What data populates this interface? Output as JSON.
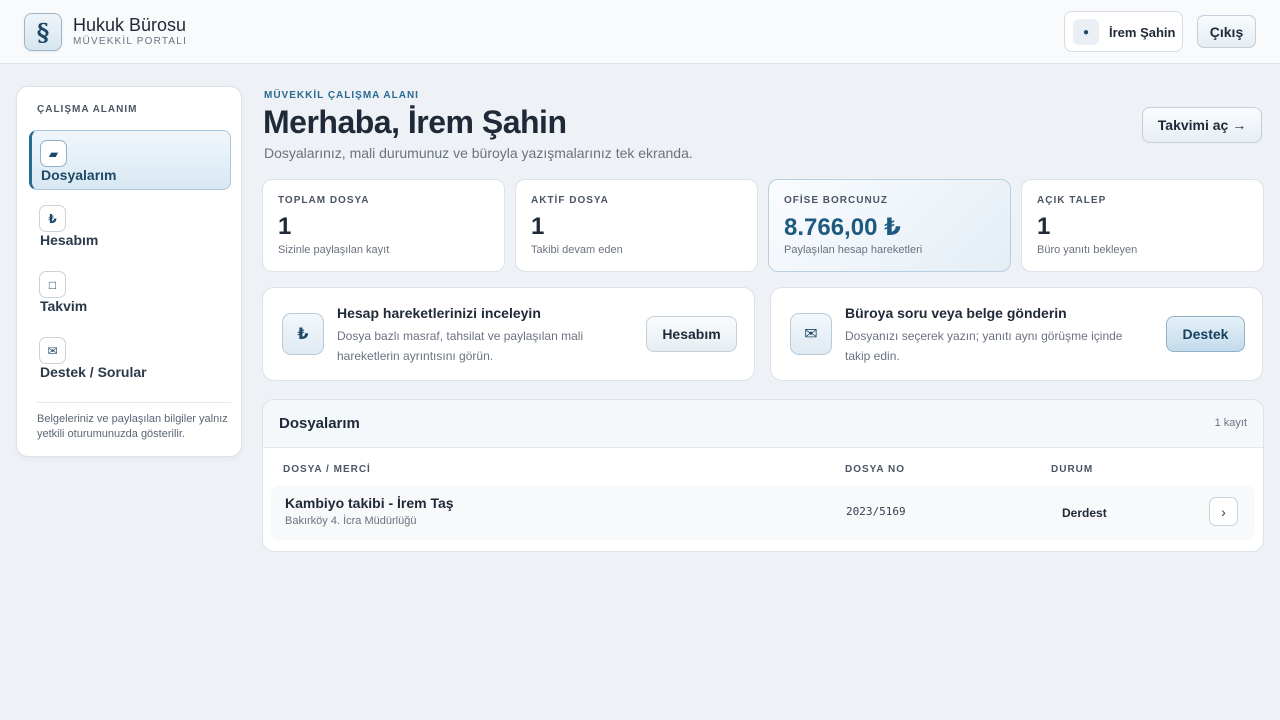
{
  "header": {
    "logo_glyph": "§",
    "brand_name": "Hukuk Bürosu",
    "brand_sub": "MÜVEKKİL PORTALI",
    "user_avatar_glyph": "●",
    "user_name": "İrem Şahin",
    "logout_label": "Çıkış"
  },
  "sidebar": {
    "title": "ÇALIŞMA ALANIM",
    "items": [
      {
        "label": "Dosyalarım",
        "icon": "folder-icon",
        "glyph": "▰",
        "active": true
      },
      {
        "label": "Hesabım",
        "icon": "lira-icon",
        "glyph": "₺",
        "active": false
      },
      {
        "label": "Takvim",
        "icon": "calendar-icon",
        "glyph": "□",
        "active": false
      },
      {
        "label": "Destek / Sorular",
        "icon": "mail-icon",
        "glyph": "✉",
        "active": false
      }
    ],
    "note": "Belgeleriniz ve paylaşılan bilgiler yalnız yetkili oturumunuzda gösterilir."
  },
  "main": {
    "eyebrow": "MÜVEKKİL ÇALIŞMA ALANI",
    "greeting": "Merhaba, İrem Şahin",
    "subtitle": "Dosyalarınız, mali durumunuz ve büroyla yazışmalarınız tek ekranda.",
    "calendar_button": "Takvimi aç →"
  },
  "stats": [
    {
      "label": "TOPLAM DOSYA",
      "value": "1",
      "desc": "Sizinle paylaşılan kayıt"
    },
    {
      "label": "AKTİF DOSYA",
      "value": "1",
      "desc": "Takibi devam eden"
    },
    {
      "label": "OFİSE BORCUNUZ",
      "value": "8.766,00 ₺",
      "desc": "Paylaşılan hesap hareketleri"
    },
    {
      "label": "AÇIK TALEP",
      "value": "1",
      "desc": "Büro yanıtı bekleyen"
    }
  ],
  "actions": [
    {
      "icon": "lira-icon",
      "glyph": "₺",
      "title": "Hesap hareketlerinizi inceleyin",
      "desc": "Dosya bazlı masraf, tahsilat ve paylaşılan mali hareketlerin ayrıntısını görün.",
      "button": "Hesabım"
    },
    {
      "icon": "mail-icon",
      "glyph": "✉",
      "title": "Büroya soru veya belge gönderin",
      "desc": "Dosyanızı seçerek yazın; yanıtı aynı görüşme içinde takip edin.",
      "button": "Destek"
    }
  ],
  "files": {
    "title": "Dosyalarım",
    "count": "1 kayıt",
    "columns": [
      "DOSYA / MERCİ",
      "DOSYA NO",
      "DURUM"
    ],
    "rows": [
      {
        "title": "Kambiyo takibi - İrem Taş",
        "court": "Bakırköy 4. İcra Müdürlüğü",
        "no": "2023/5169",
        "status": "Derdest",
        "arrow": "›"
      }
    ]
  },
  "colors": {
    "accent": "#2a6b93",
    "debt_value": "#1e5a80",
    "background": "#eef1f5"
  }
}
